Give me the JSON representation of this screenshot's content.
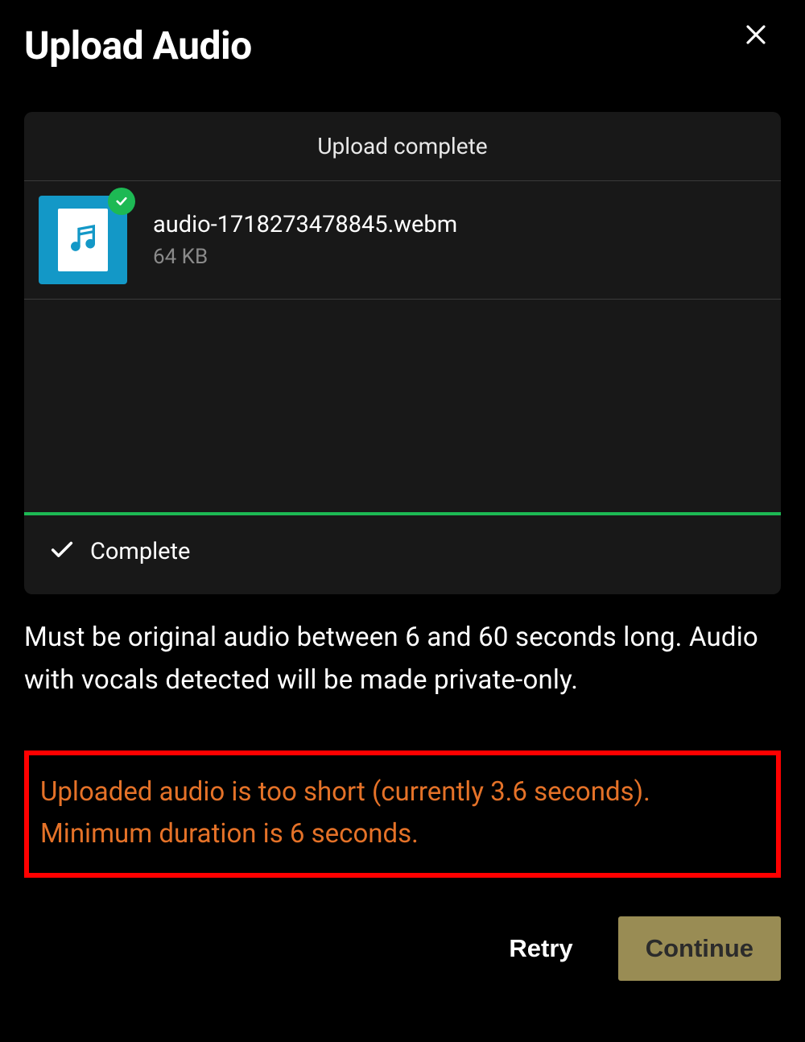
{
  "modal": {
    "title": "Upload Audio",
    "status_header": "Upload complete",
    "file": {
      "name": "audio-1718273478845.webm",
      "size": "64 KB"
    },
    "complete_label": "Complete",
    "info_text": "Must be original audio between 6 and 60 seconds long. Audio with vocals detected will be made private-only.",
    "error_text": "Uploaded audio is too short (currently 3.6 seconds). Minimum duration is 6 seconds.",
    "buttons": {
      "retry": "Retry",
      "continue": "Continue"
    }
  }
}
